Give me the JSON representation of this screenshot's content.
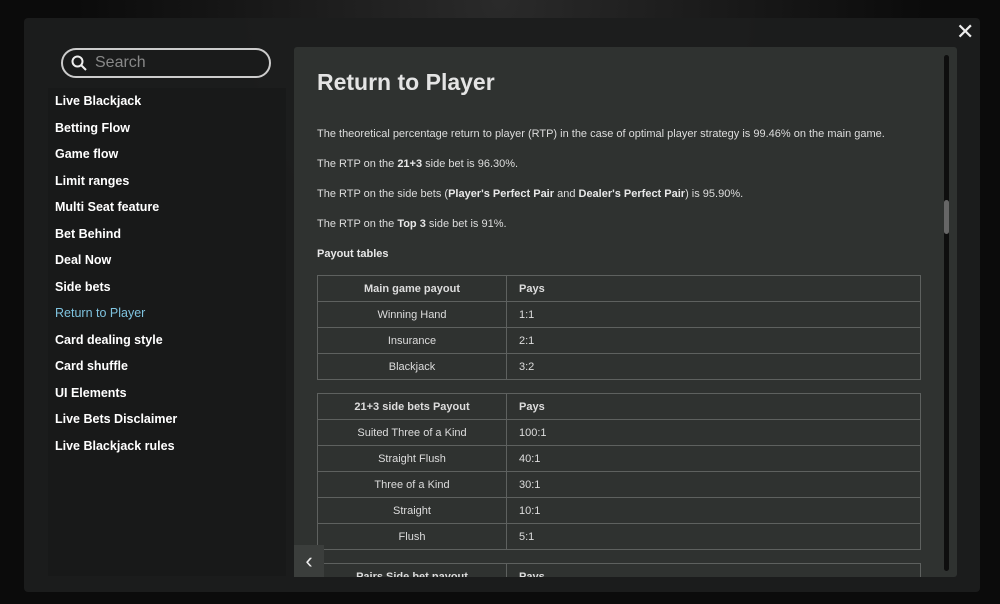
{
  "search": {
    "placeholder": "Search"
  },
  "close_label": "✕",
  "sidebar": {
    "items": [
      {
        "label": "Live Blackjack"
      },
      {
        "label": "Betting Flow"
      },
      {
        "label": "Game flow"
      },
      {
        "label": "Limit ranges"
      },
      {
        "label": "Multi Seat feature"
      },
      {
        "label": "Bet Behind"
      },
      {
        "label": "Deal Now"
      },
      {
        "label": "Side bets"
      },
      {
        "label": "Return to Player",
        "active": true
      },
      {
        "label": "Card dealing style"
      },
      {
        "label": "Card shuffle"
      },
      {
        "label": "UI Elements"
      },
      {
        "label": "Live Bets Disclaimer"
      },
      {
        "label": "Live Blackjack rules"
      }
    ]
  },
  "main": {
    "title": "Return to Player",
    "p1": "The theoretical percentage return to player (RTP) in the case of optimal player strategy is 99.46% on the main game.",
    "p2": {
      "a": "The RTP on the ",
      "b": "21+3",
      "c": " side bet is 96.30%."
    },
    "p3": {
      "a": "The RTP on the side bets (",
      "b": "Player's Perfect Pair",
      "c": " and ",
      "d": "Dealer's Perfect Pair",
      "e": ") is 95.90%."
    },
    "p4": {
      "a": "The RTP on the ",
      "b": "Top 3",
      "c": " side bet is 91%."
    },
    "payout_heading": "Payout tables",
    "tables": [
      {
        "headers": [
          "Main game payout",
          "Pays"
        ],
        "rows": [
          [
            "Winning Hand",
            "1:1"
          ],
          [
            "Insurance",
            "2:1"
          ],
          [
            "Blackjack",
            "3:2"
          ]
        ]
      },
      {
        "headers": [
          "21+3 side bets Payout",
          "Pays"
        ],
        "rows": [
          [
            "Suited Three of a Kind",
            "100:1"
          ],
          [
            "Straight Flush",
            "40:1"
          ],
          [
            "Three of a Kind",
            "30:1"
          ],
          [
            "Straight",
            "10:1"
          ],
          [
            "Flush",
            "5:1"
          ]
        ]
      },
      {
        "headers": [
          "Pairs Side bet payout",
          "Pays"
        ],
        "rows": []
      }
    ]
  },
  "back_label": "‹"
}
